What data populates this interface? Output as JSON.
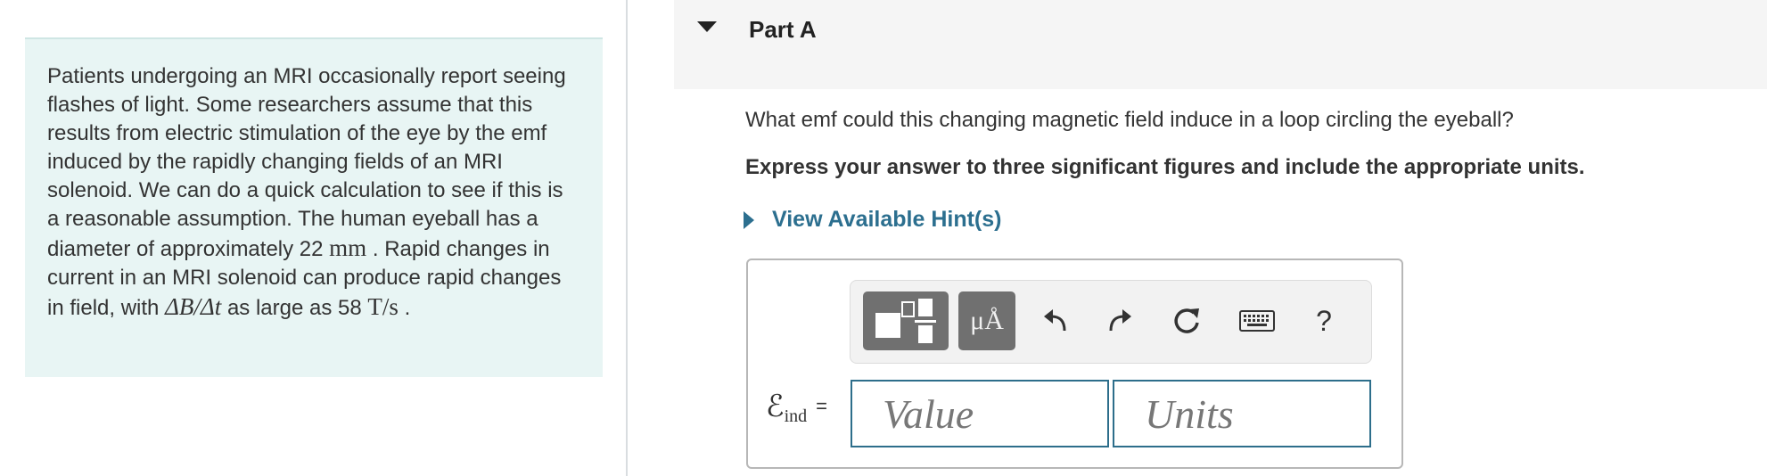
{
  "problem": {
    "text_1": "Patients undergoing an MRI occasionally report seeing flashes of light. Some researchers assume that this results from electric stimulation of the eye by the emf induced by the rapidly changing fields of an MRI solenoid. We can do a quick calculation to see if this is a reasonable assumption. The human eyeball has a diameter of approximately 22",
    "diameter_unit": "mm",
    "text_2": ". Rapid changes in current in an MRI solenoid can produce rapid changes in field, with",
    "rate_expression": "ΔB/Δt",
    "text_3": "as large as 58",
    "rate_unit": "T/s",
    "text_4": "."
  },
  "part": {
    "title": "Part A",
    "question": "What emf could this changing magnetic field induce in a loop circling the eyeball?",
    "instruction": "Express your answer to three significant figures and include the appropriate units.",
    "hint_label": "View Available Hint(s)"
  },
  "toolbar": {
    "template_icon": "fraction-template-icon",
    "units_label": "μÅ",
    "undo_icon": "undo-icon",
    "redo_icon": "redo-icon",
    "reset_icon": "reset-icon",
    "keyboard_icon": "keyboard-icon",
    "help_label": "?"
  },
  "answer": {
    "symbol": "ℰ",
    "subscript": "ind",
    "equals": "=",
    "value_placeholder": "Value",
    "units_placeholder": "Units"
  },
  "colors": {
    "panel_bg": "#e8f5f4",
    "link": "#2c6f8f",
    "input_border": "#2d6e8b",
    "toolbar_button": "#707070"
  }
}
